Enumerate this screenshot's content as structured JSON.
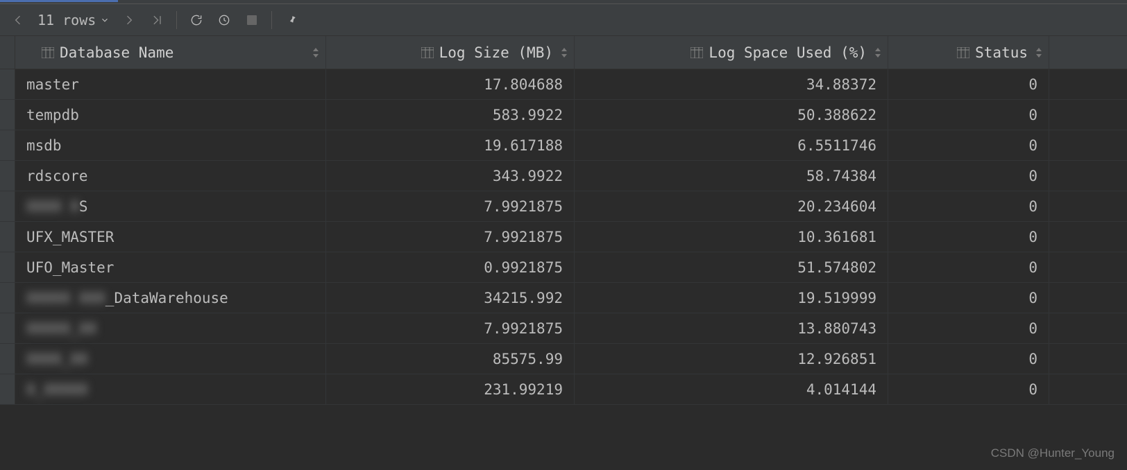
{
  "toolbar": {
    "rows_label": "11 rows"
  },
  "columns": [
    {
      "label": "Database Name"
    },
    {
      "label": "Log Size (MB)"
    },
    {
      "label": "Log Space Used (%)"
    },
    {
      "label": "Status"
    }
  ],
  "rows": [
    {
      "name": "master",
      "log_size": "17.804688",
      "used_pct": "34.88372",
      "status": "0",
      "obscured": false
    },
    {
      "name": "tempdb",
      "log_size": "583.9922",
      "used_pct": "50.388622",
      "status": "0",
      "obscured": false
    },
    {
      "name": "msdb",
      "log_size": "19.617188",
      "used_pct": "6.5511746",
      "status": "0",
      "obscured": false
    },
    {
      "name": "rdscore",
      "log_size": "343.9922",
      "used_pct": "58.74384",
      "status": "0",
      "obscured": false
    },
    {
      "name_pre": "XXXX X",
      "name_suf": "S",
      "log_size": "7.9921875",
      "used_pct": "20.234604",
      "status": "0",
      "obscured": "partial"
    },
    {
      "name": "UFX_MASTER",
      "log_size": "7.9921875",
      "used_pct": "10.361681",
      "status": "0",
      "obscured": false
    },
    {
      "name": "UFO_Master",
      "log_size": "0.9921875",
      "used_pct": "51.574802",
      "status": "0",
      "obscured": false
    },
    {
      "name_pre": "XXXXX XXX",
      "name_suf": "_DataWarehouse",
      "log_size": "34215.992",
      "used_pct": "19.519999",
      "status": "0",
      "obscured": "partial"
    },
    {
      "name": "XXXXX_XX",
      "log_size": "7.9921875",
      "used_pct": "13.880743",
      "status": "0",
      "obscured": true
    },
    {
      "name": "XXXX_XX",
      "log_size": "85575.99",
      "used_pct": "12.926851",
      "status": "0",
      "obscured": true
    },
    {
      "name": "X_XXXXX",
      "log_size": "231.99219",
      "used_pct": "4.014144",
      "status": "0",
      "obscured": true
    }
  ],
  "footer": {
    "watermark": "CSDN @Hunter_Young"
  }
}
